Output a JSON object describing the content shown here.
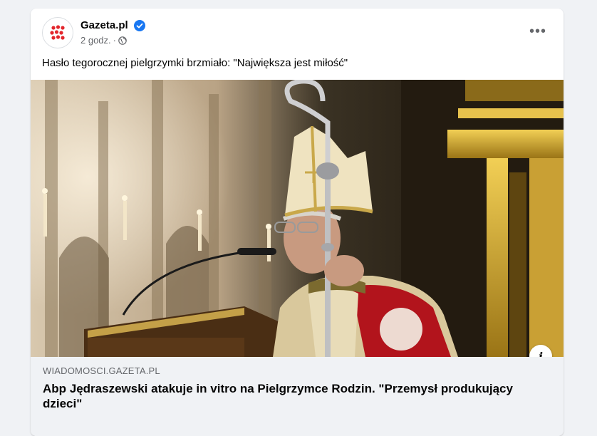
{
  "post": {
    "page_name": "Gazeta.pl",
    "verified_icon": "verified-badge-icon",
    "time": "2 godz.",
    "separator": "·",
    "audience_icon": "globe-icon",
    "text": "Hasło tegorocznej pielgrzymki brzmiało: \"Największa jest miłość\"",
    "more_icon": "more-options-icon",
    "more_label": "•••"
  },
  "link_preview": {
    "info_label": "i",
    "domain": "WIADOMOSCI.GAZETA.PL",
    "headline": "Abp Jędraszewski atakuje in vitro na Pielgrzymce Rodzin. \"Przemysł produkujący dzieci\""
  },
  "colors": {
    "brand_red": "#e3272d",
    "verified_blue": "#1877f2",
    "secondary_text": "#65676b"
  }
}
